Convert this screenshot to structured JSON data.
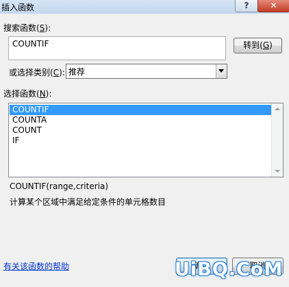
{
  "window": {
    "title": "插入函数",
    "help_button": "?",
    "close_button": "✕"
  },
  "search": {
    "label_prefix": "搜索函数(",
    "label_key": "S",
    "label_suffix": "):",
    "value": "COUNTIF",
    "goto_prefix": "转到(",
    "goto_key": "G",
    "goto_suffix": ")"
  },
  "category": {
    "label_prefix": "或选择类别(",
    "label_key": "C",
    "label_suffix": "):",
    "selected": "推荐"
  },
  "function_list": {
    "label_prefix": "选择函数(",
    "label_key": "N",
    "label_suffix": "):",
    "items": [
      "COUNTIF",
      "COUNTA",
      "COUNT",
      "IF"
    ],
    "selected_index": 0
  },
  "details": {
    "syntax": "COUNTIF(range,criteria)",
    "description": "计算某个区域中满足给定条件的单元格数目"
  },
  "footer": {
    "help_link": "有关该函数的帮助",
    "ok_label": "确定",
    "cancel_label": "取消"
  },
  "watermark": "UiBQ.CoM"
}
